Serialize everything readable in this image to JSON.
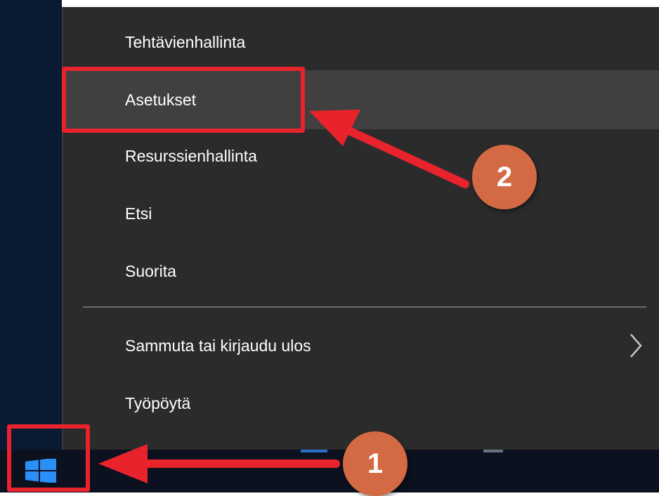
{
  "menu": {
    "items": [
      {
        "label": "Tehtävienhallinta"
      },
      {
        "label": "Asetukset"
      },
      {
        "label": "Resurssienhallinta"
      },
      {
        "label": "Etsi"
      },
      {
        "label": "Suorita"
      },
      {
        "label": "Sammuta tai kirjaudu ulos"
      },
      {
        "label": "Työpöytä"
      }
    ],
    "highlighted_item": "Asetukset"
  },
  "annotations": {
    "step1": "1",
    "step2": "2",
    "highlight_color": "#e8232c",
    "badge_color": "#d46a44"
  },
  "taskbar": {
    "start_icon": "windows-logo-icon",
    "start_icon_color": "#2a8ff7"
  }
}
